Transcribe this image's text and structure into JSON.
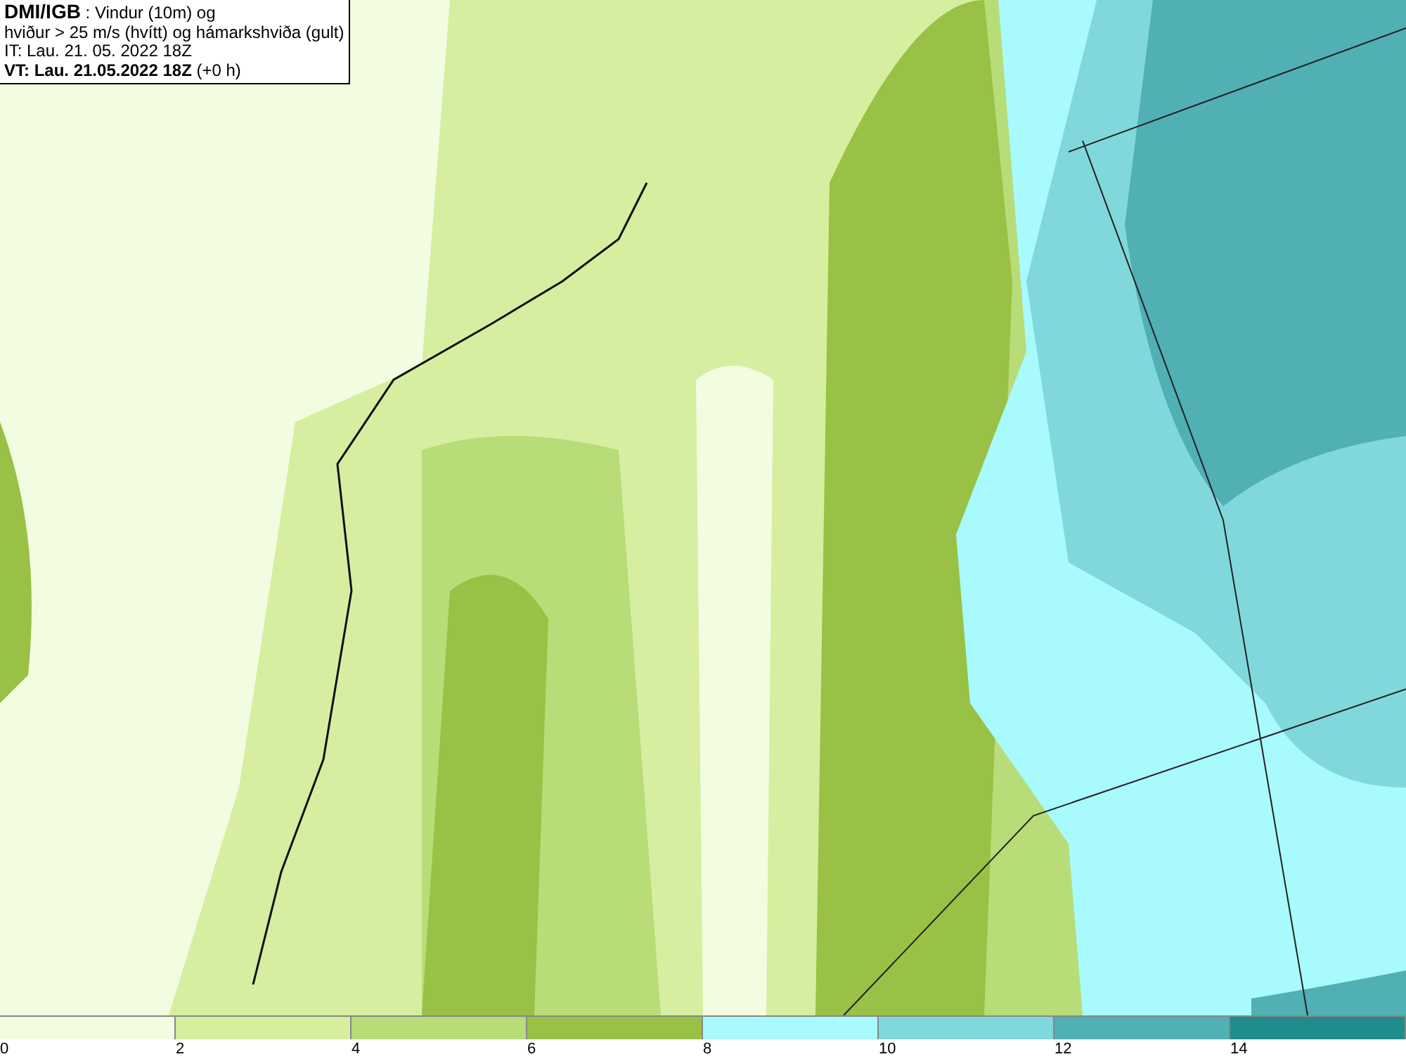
{
  "title_box": {
    "lines": [
      "**DMI/IGB** : Vindur (10m) og",
      "hviður > 25 m/s (hvítt) og hámarkshviða (gult)",
      "IT: Lau. 21. 05. 2022 18Z",
      "**VT: Lau. 21.05.2022 18Z** (+0 h)"
    ]
  },
  "legend": [
    {
      "label": "0",
      "color": "#f2fce0"
    },
    {
      "label": "2",
      "color": "#d6eea0"
    },
    {
      "label": "4",
      "color": "#b8dc78"
    },
    {
      "label": "6",
      "color": "#98c146"
    },
    {
      "label": "8",
      "color": "#a8fafc"
    },
    {
      "label": "10",
      "color": "#80d8dc"
    },
    {
      "label": "12",
      "color": "#50b0b4"
    },
    {
      "label": "14",
      "color": "#208c8c"
    }
  ]
}
